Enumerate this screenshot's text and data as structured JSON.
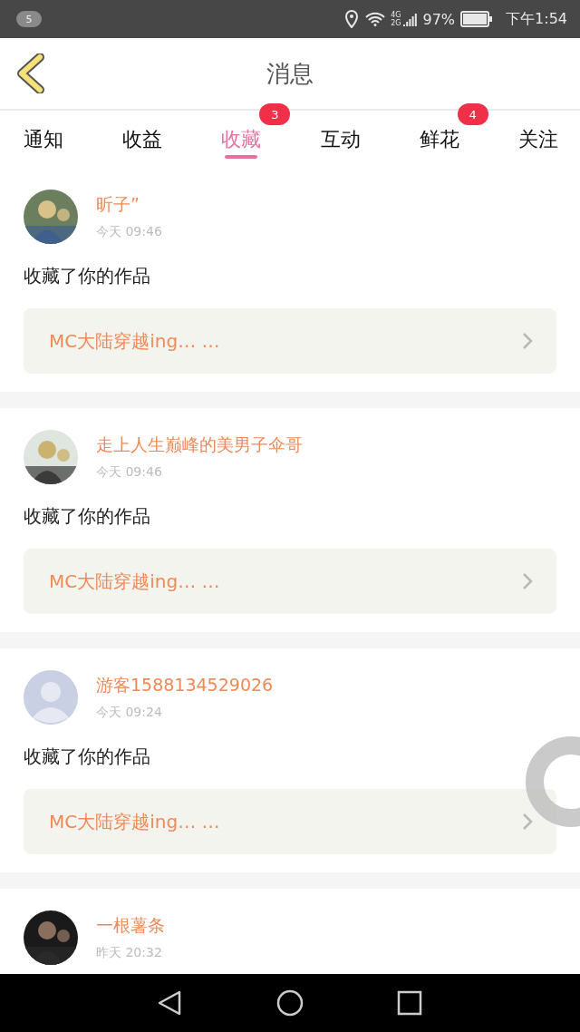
{
  "status_bar": {
    "notification_count": "5",
    "network_top": "4G",
    "network_bottom": "2G",
    "battery": "97%",
    "time": "下午1:54"
  },
  "header": {
    "title": "消息"
  },
  "tabs": [
    {
      "label": "通知",
      "selected": false
    },
    {
      "label": "收益",
      "selected": false
    },
    {
      "label": "收藏",
      "selected": true,
      "badge": "3"
    },
    {
      "label": "互动",
      "selected": false
    },
    {
      "label": "鲜花",
      "selected": false,
      "badge": "4"
    },
    {
      "label": "关注",
      "selected": false
    }
  ],
  "messages": [
    {
      "name": "昕子”",
      "time": "今天 09:46",
      "action": "收藏了你的作品",
      "work_title": "MC大陆穿越ing… …"
    },
    {
      "name": "走上人生巅峰的美男子伞哥",
      "time": "今天 09:46",
      "action": "收藏了你的作品",
      "work_title": "MC大陆穿越ing… …"
    },
    {
      "avatar": {
        "kind": "default"
      },
      "name": "游客1588134529026",
      "time": "今天 09:24",
      "action": "收藏了你的作品",
      "work_title": "MC大陆穿越ing… …"
    },
    {
      "name": "一根薯条",
      "time": "昨天 20:32"
    }
  ]
}
